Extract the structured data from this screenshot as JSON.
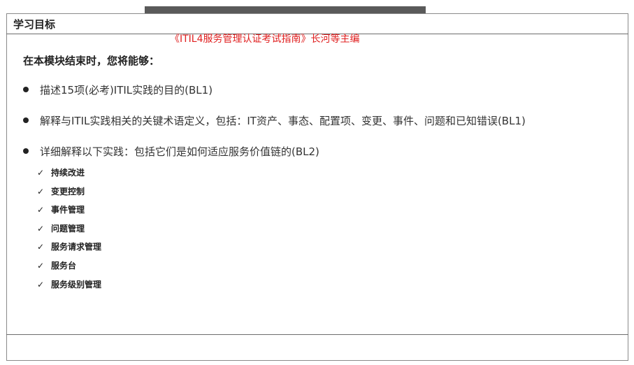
{
  "section_title": "学习目标",
  "source_note": "《ITIL4服务管理认证考试指南》长河等主编",
  "intro": "在本模块结束时，您将能够：",
  "bullets": [
    "描述15项(必考)ITIL实践的目的(BL1)",
    "解释与ITIL实践相关的关键术语定义，包括：IT资产、事态、配置项、变更、事件、问题和已知错误(BL1)",
    "详细解释以下实践：包括它们是如何适应服务价值链的(BL2)"
  ],
  "practices": [
    "持续改进",
    "变更控制",
    "事件管理",
    "问题管理",
    "服务请求管理",
    "服务台",
    "服务级别管理"
  ],
  "check_mark": "✓",
  "colors": {
    "note_red": "#e02020",
    "bar_gray": "#5a5a5a"
  }
}
